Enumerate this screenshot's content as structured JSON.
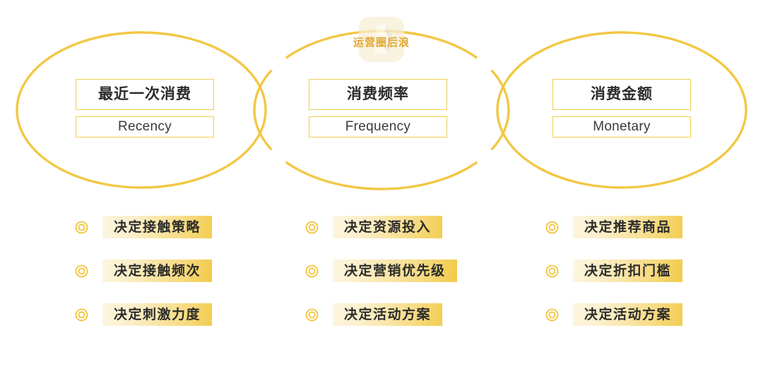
{
  "watermark": {
    "text": "运营圈后浪",
    "glyph_name": "faded-app-logo"
  },
  "colors": {
    "gold": "#f2c744",
    "gold_border": "#f0cf52",
    "chip_from": "#fdf6e0",
    "chip_to": "#f2cd4f",
    "text_dark": "#2b2b2b",
    "watermark_text": "#e0a72e"
  },
  "columns": [
    {
      "id": "recency",
      "title_cn": "最近一次消费",
      "title_en": "Recency",
      "items": [
        {
          "label": "决定接触策略"
        },
        {
          "label": "决定接触频次"
        },
        {
          "label": "决定刺激力度"
        }
      ]
    },
    {
      "id": "frequency",
      "title_cn": "消费频率",
      "title_en": "Frequency",
      "items": [
        {
          "label": "决定资源投入"
        },
        {
          "label": "决定营销优先级"
        },
        {
          "label": "决定活动方案"
        }
      ]
    },
    {
      "id": "monetary",
      "title_cn": "消费金额",
      "title_en": "Monetary",
      "items": [
        {
          "label": "决定推荐商品"
        },
        {
          "label": "决定折扣门槛"
        },
        {
          "label": "决定活动方案"
        }
      ]
    }
  ]
}
